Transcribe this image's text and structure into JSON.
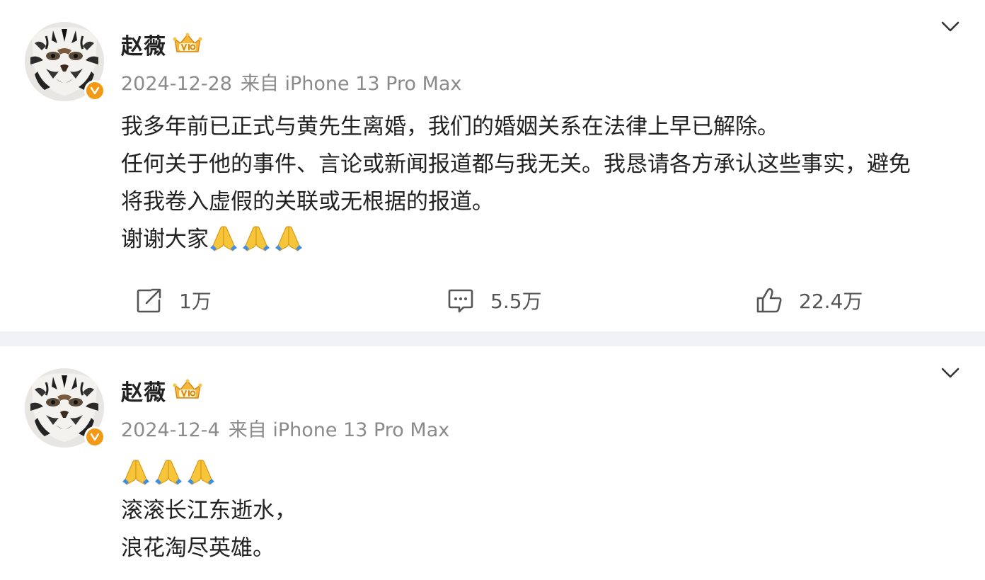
{
  "posts": [
    {
      "username": "赵薇",
      "date": "2024-12-28",
      "source": "来自 iPhone 13 Pro Max",
      "content_lines": [
        "我多年前已正式与黄先生离婚，我们的婚姻关系在法律上早已解除。",
        "任何关于他的事件、言论或新闻报道都与我无关。我恳请各方承认这些事实，避免",
        "将我卷入虚假的关联或无根据的报道。",
        "谢谢大家"
      ],
      "closing_emojis": [
        "prayer-hands-emoji",
        "prayer-hands-emoji",
        "prayer-hands-emoji"
      ],
      "repost_count": "1万",
      "comment_count": "5.5万",
      "like_count": "22.4万"
    },
    {
      "username": "赵薇",
      "date": "2024-12-4",
      "source": "来自 iPhone 13 Pro Max",
      "leading_emojis": [
        "prayer-hands-emoji",
        "prayer-hands-emoji",
        "prayer-hands-emoji"
      ],
      "content_lines": [
        "滚滚长江东逝水，",
        "浪花淘尽英雄。"
      ]
    }
  ],
  "icons": {
    "verified": "verified-badge-icon",
    "vip": "vip-crown-badge-icon",
    "more": "chevron-down-icon",
    "repost": "repost-icon",
    "comment": "comment-icon",
    "like": "thumbs-up-icon"
  },
  "colors": {
    "verified_badge": "#f29a15",
    "meta_text": "#8a8a8a",
    "feed_background": "#f1f2f5"
  }
}
